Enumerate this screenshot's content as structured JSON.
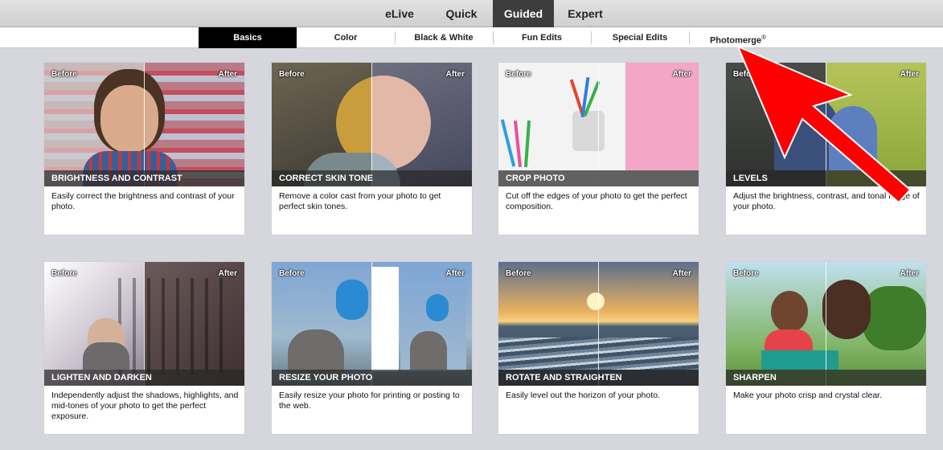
{
  "modes": [
    {
      "label": "eLive",
      "active": false
    },
    {
      "label": "Quick",
      "active": false
    },
    {
      "label": "Guided",
      "active": true
    },
    {
      "label": "Expert",
      "active": false
    }
  ],
  "tabs": [
    {
      "label": "Basics",
      "active": true
    },
    {
      "label": "Color",
      "active": false
    },
    {
      "label": "Black & White",
      "active": false
    },
    {
      "label": "Fun Edits",
      "active": false
    },
    {
      "label": "Special Edits",
      "active": false
    },
    {
      "label": "Photomerge",
      "active": false,
      "mark": "®"
    }
  ],
  "thumb_labels": {
    "before": "Before",
    "after": "After"
  },
  "cards": [
    {
      "title": "BRIGHTNESS AND CONTRAST",
      "desc": "Easily correct the brightness and contrast of your photo."
    },
    {
      "title": "CORRECT SKIN TONE",
      "desc": "Remove a color cast from your photo to get perfect skin tones."
    },
    {
      "title": "CROP PHOTO",
      "desc": "Cut off the edges of your photo to get the perfect composition."
    },
    {
      "title": "LEVELS",
      "desc": "Adjust the brightness, contrast, and tonal range of your photo."
    },
    {
      "title": "LIGHTEN AND DARKEN",
      "desc": "Independently adjust the shadows, highlights, and mid-tones of your photo to get the perfect exposure."
    },
    {
      "title": "RESIZE YOUR PHOTO",
      "desc": "Easily resize your photo for printing or posting to the web."
    },
    {
      "title": "ROTATE AND STRAIGHTEN",
      "desc": "Easily level out the horizon of your photo."
    },
    {
      "title": "SHARPEN",
      "desc": "Make your photo crisp and crystal clear."
    }
  ],
  "colors": {
    "active_tab": "#000000",
    "active_mode": "#3d3d3d",
    "arrow": "#ff0000",
    "background": "#d6d7dc"
  }
}
